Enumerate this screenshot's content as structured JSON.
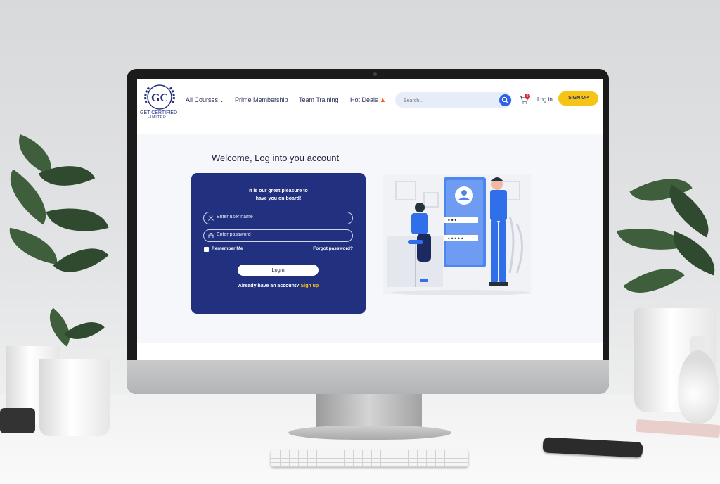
{
  "header": {
    "logo_text": "GET CERTIFIED",
    "logo_subtext": "LIMITED",
    "logo_monogram": "GC",
    "nav": [
      {
        "label": "All Courses",
        "has_dropdown": true
      },
      {
        "label": "Prime Membership"
      },
      {
        "label": "Team Training"
      },
      {
        "label": "Hot Deals",
        "icon": "fire-icon"
      }
    ],
    "search": {
      "placeholder": "Search..."
    },
    "cart_count": "0",
    "login_label": "Log in",
    "signup_label": "SIGN UP"
  },
  "main": {
    "title": "Welcome, Log into you account",
    "card": {
      "welcome_line1": "It is our great pleasure to",
      "welcome_line2": "have you on board!",
      "username_placeholder": "Enter user name",
      "password_placeholder": "Enter password",
      "remember_label": "Remember Me",
      "forgot_label": "Forgot password?",
      "login_button": "Login",
      "already_text": "Already have an account?",
      "signup_link": "Sign up"
    }
  },
  "colors": {
    "card_bg": "#213180",
    "accent_yellow": "#f6c416",
    "search_button": "#2f62e6",
    "badge_red": "#e5232c"
  }
}
